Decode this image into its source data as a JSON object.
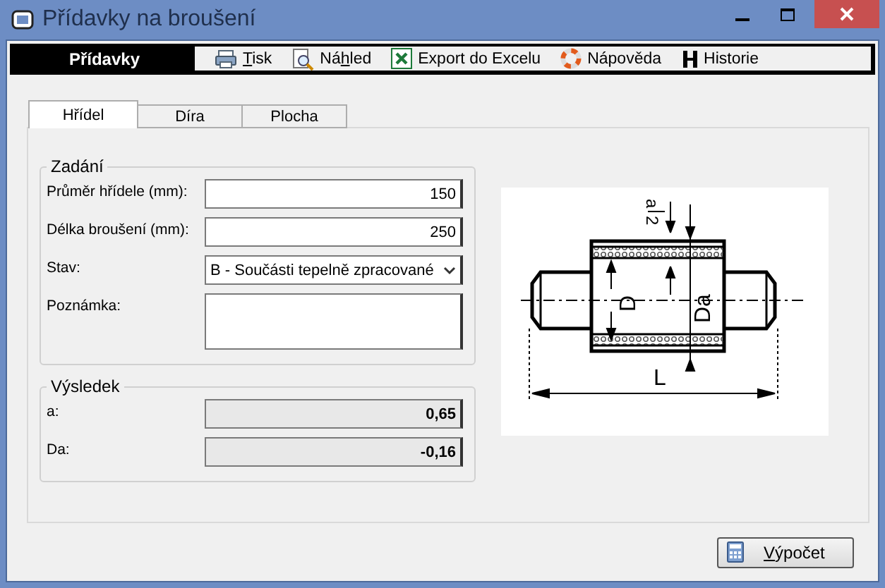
{
  "window": {
    "title": "Přídavky na broušení"
  },
  "toolbar": [
    {
      "kind": "heading",
      "label": "Přídavky"
    },
    {
      "kind": "button",
      "key": "T",
      "after": "isk"
    },
    {
      "kind": "button",
      "before": "Ná",
      "key": "h",
      "after": "led"
    },
    {
      "kind": "button",
      "after": "Export do Excelu"
    },
    {
      "kind": "button",
      "after": "Nápověda"
    },
    {
      "kind": "button",
      "after": "Historie"
    }
  ],
  "tabs": [
    {
      "label": "Hřídel",
      "selected": true
    },
    {
      "label": "Díra",
      "selected": false
    },
    {
      "label": "Plocha",
      "selected": false
    }
  ],
  "input_group": {
    "title": "Zadání",
    "fields": [
      {
        "kind": "text",
        "label": "Průměr hřídele (mm):",
        "value": "150"
      },
      {
        "kind": "text",
        "label": "Délka broušení (mm):",
        "value": "250"
      },
      {
        "kind": "select",
        "label": "Stav:",
        "value": "B - Součásti tepelně zpracované"
      },
      {
        "kind": "memo",
        "label": "Poznámka:"
      }
    ]
  },
  "result_group": {
    "title": "Výsledek",
    "fields": [
      {
        "label": "a:",
        "value": "0,65"
      },
      {
        "label": "Da:",
        "value": "-0,16"
      }
    ]
  },
  "diagram": {
    "numerator": "a",
    "denominator": "2",
    "inner_diameter": "D",
    "outer_diameter": "Da",
    "length": "L"
  },
  "compute_button": {
    "key": "V",
    "after": "ýpočet"
  }
}
